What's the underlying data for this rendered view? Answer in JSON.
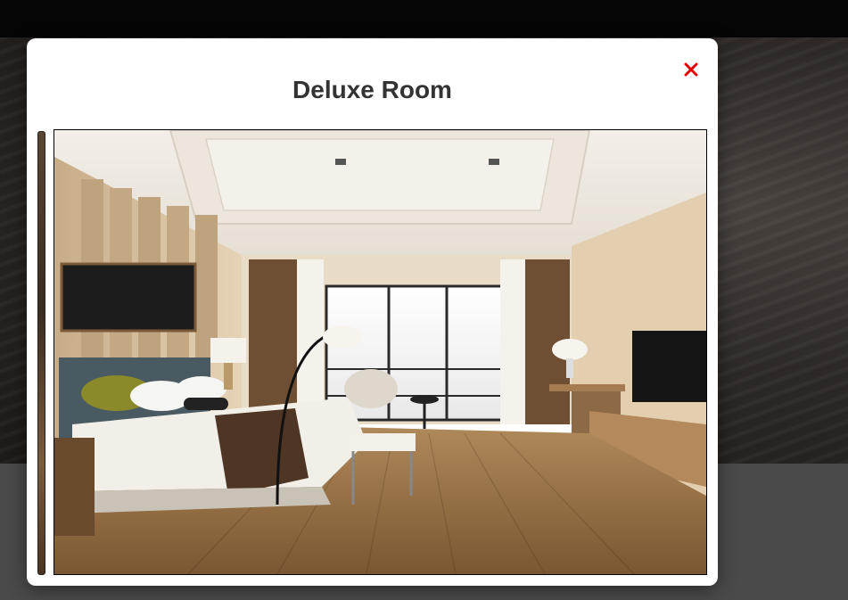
{
  "modal": {
    "title": "Deluxe Room",
    "close_icon": "close-x-icon",
    "close_color": "#e00000"
  },
  "carousel": {
    "current_image": "deluxe-room-bedroom-photo",
    "previous_image": "previous-room-photo"
  }
}
